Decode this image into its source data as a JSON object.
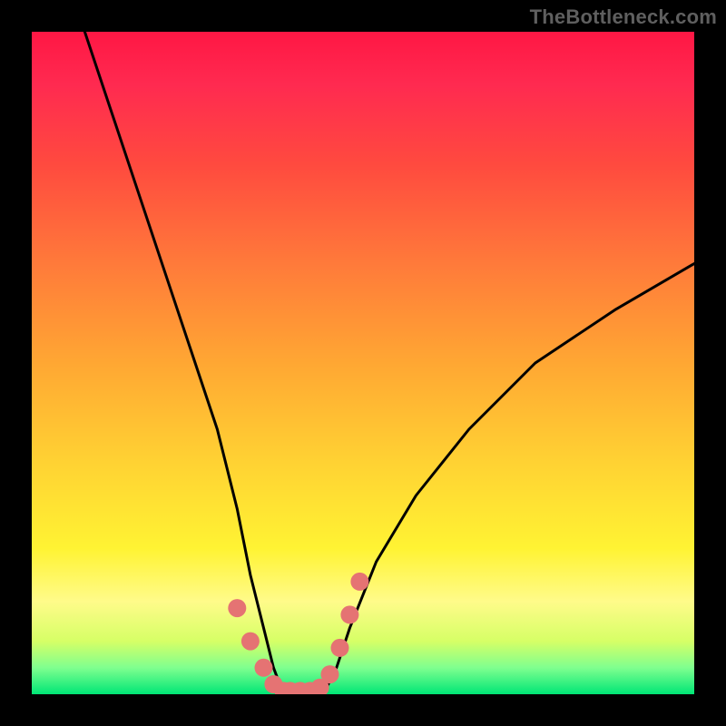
{
  "watermark": "TheBottleneck.com",
  "chart_data": {
    "type": "line",
    "title": "",
    "xlabel": "",
    "ylabel": "",
    "xlim": [
      0,
      100
    ],
    "ylim": [
      0,
      100
    ],
    "series": [
      {
        "name": "bottleneck-curve",
        "x": [
          8,
          12,
          16,
          20,
          24,
          28,
          31,
          33,
          35,
          36.5,
          38,
          40,
          42,
          44,
          46,
          48,
          52,
          58,
          66,
          76,
          88,
          100
        ],
        "y": [
          100,
          88,
          76,
          64,
          52,
          40,
          28,
          18,
          10,
          4,
          0,
          0,
          0,
          0,
          4,
          10,
          20,
          30,
          40,
          50,
          58,
          65
        ]
      }
    ],
    "highlight": {
      "name": "highlight-dots",
      "x": [
        31,
        33,
        35,
        36.5,
        38,
        39,
        40.5,
        42,
        43.5,
        45,
        46.5,
        48,
        49.5
      ],
      "y": [
        13,
        8,
        4,
        1.5,
        0.5,
        0.5,
        0.5,
        0.5,
        1,
        3,
        7,
        12,
        17
      ]
    },
    "colors": {
      "curve": "#000000",
      "highlight": "#e57373",
      "background_top": "#ff1744",
      "background_bottom": "#00e676"
    }
  }
}
